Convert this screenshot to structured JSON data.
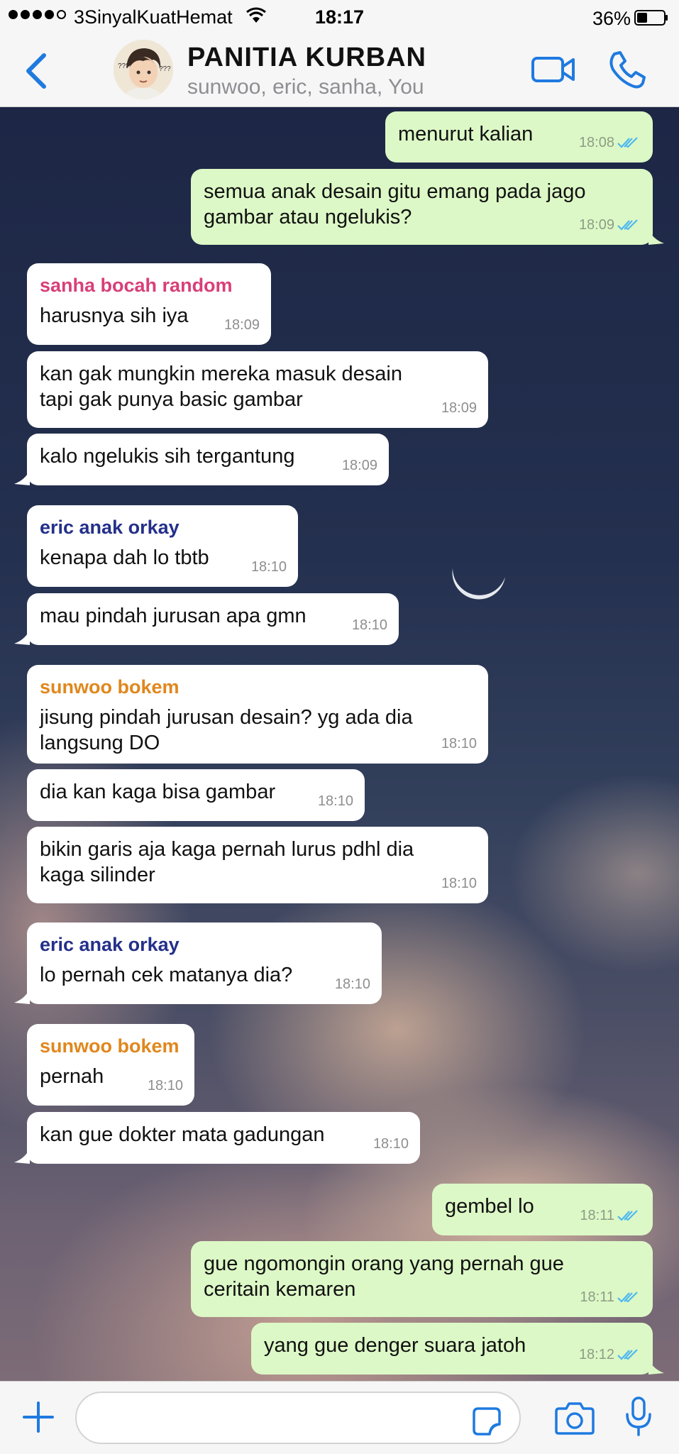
{
  "status_bar": {
    "carrier": "3SinyalKuatHemat",
    "time": "18:17",
    "battery": "36%"
  },
  "header": {
    "title": "PANITIA KURBAN",
    "members": "sunwoo, eric, sanha, You"
  },
  "colors": {
    "accent": "#1f7ae0",
    "outgoing_bubble": "#dcf8c6",
    "incoming_bubble": "#ffffff",
    "read_ticks": "#4fb8f0",
    "sender_sanha": "#d83f79",
    "sender_eric": "#24308a",
    "sender_sunwoo": "#e0871d"
  },
  "messages": [
    {
      "dir": "out",
      "text": "menurut kalian",
      "time": "18:08"
    },
    {
      "dir": "out",
      "text": "semua anak desain gitu emang pada jago gambar atau ngelukis?",
      "time": "18:09"
    },
    {
      "dir": "in",
      "sender": "sanha bocah random",
      "text": "harusnya sih iya",
      "time": "18:09"
    },
    {
      "dir": "in",
      "text": "kan gak mungkin mereka masuk desain tapi gak punya basic gambar",
      "time": "18:09"
    },
    {
      "dir": "in",
      "text": "kalo ngelukis sih tergantung",
      "time": "18:09"
    },
    {
      "dir": "in",
      "sender": "eric anak orkay",
      "text": "kenapa dah lo tbtb",
      "time": "18:10"
    },
    {
      "dir": "in",
      "text": "mau pindah jurusan apa gmn",
      "time": "18:10"
    },
    {
      "dir": "in",
      "sender": "sunwoo bokem",
      "text": "jisung pindah jurusan desain? yg ada dia langsung DO",
      "time": "18:10"
    },
    {
      "dir": "in",
      "text": "dia kan kaga bisa gambar",
      "time": "18:10"
    },
    {
      "dir": "in",
      "text": "bikin garis aja kaga pernah lurus pdhl dia kaga silinder",
      "time": "18:10"
    },
    {
      "dir": "in",
      "sender": "eric anak orkay",
      "text": "lo pernah cek matanya dia?",
      "time": "18:10"
    },
    {
      "dir": "in",
      "sender": "sunwoo bokem",
      "text": "pernah",
      "time": "18:10"
    },
    {
      "dir": "in",
      "text": "kan gue dokter mata gadungan",
      "time": "18:10"
    },
    {
      "dir": "out",
      "text": "gembel lo",
      "time": "18:11"
    },
    {
      "dir": "out",
      "text": "gue ngomongin orang yang pernah gue ceritain kemaren",
      "time": "18:11"
    },
    {
      "dir": "out",
      "text": "yang gue denger suara jatoh",
      "time": "18:12"
    }
  ],
  "icons": {
    "back": "chevron-left-icon",
    "video_call": "video-camera-icon",
    "voice_call": "phone-icon",
    "attach": "plus-icon",
    "sticker": "sticker-icon",
    "camera": "camera-icon",
    "microphone": "microphone-icon"
  }
}
